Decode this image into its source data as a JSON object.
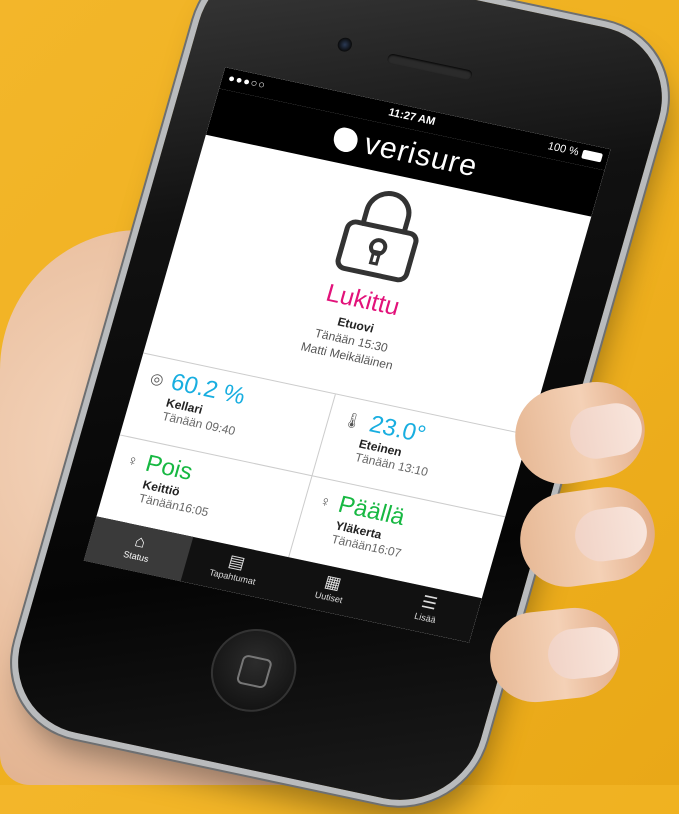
{
  "status_bar": {
    "signal": "●●●○○",
    "time": "11:27 AM",
    "battery": "100 %"
  },
  "header": {
    "brand": "verisure"
  },
  "lock": {
    "status": "Lukittu",
    "status_color": "#e2127a",
    "location": "Etuovi",
    "time": "Tänään 15:30",
    "user": "Matti Meikäläinen"
  },
  "sensors": [
    {
      "icon": "humidity-icon",
      "glyph": "💧",
      "value": "60.2 %",
      "location": "Kellari",
      "time": "Tänään 09:40",
      "color": "#18aee0"
    },
    {
      "icon": "thermometer-icon",
      "glyph": "🌡",
      "value": "23.0°",
      "location": "Eteinen",
      "time": "Tänään 13:10",
      "color": "#18aee0"
    },
    {
      "icon": "bulb-icon",
      "glyph": "💡",
      "value": "Pois",
      "location": "Keittiö",
      "time": "Tänään16:05",
      "color": "#17b842"
    },
    {
      "icon": "bulb-icon",
      "glyph": "💡",
      "value": "Päällä",
      "location": "Yläkerta",
      "time": "Tänään16:07",
      "color": "#17b842"
    }
  ],
  "tabs": [
    {
      "label": "Status",
      "icon": "home-icon",
      "glyph": "⌂",
      "active": true
    },
    {
      "label": "Tapahtumat",
      "icon": "events-icon",
      "glyph": "🗒",
      "active": false
    },
    {
      "label": "Uutiset",
      "icon": "news-icon",
      "glyph": "📰",
      "active": false
    },
    {
      "label": "Lisää",
      "icon": "menu-icon",
      "glyph": "☰",
      "active": false
    }
  ]
}
